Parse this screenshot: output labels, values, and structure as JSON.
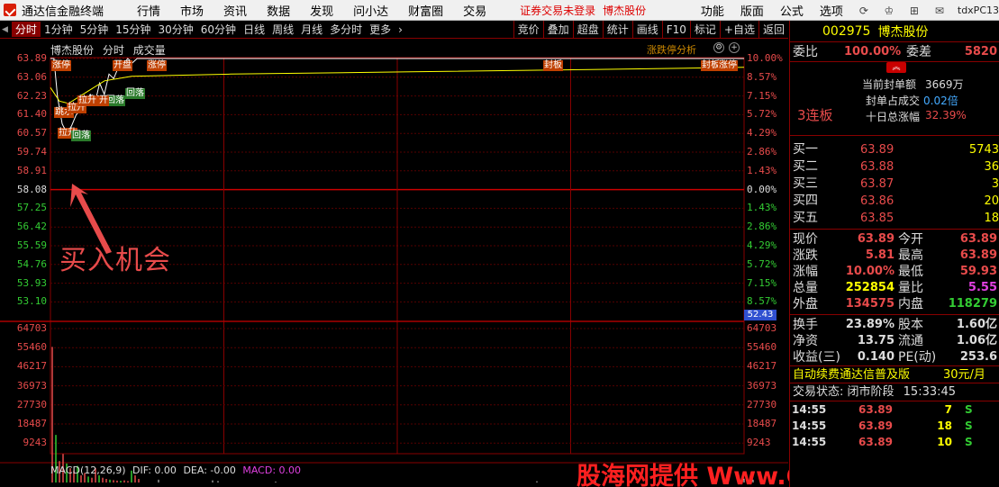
{
  "app": {
    "title": "通达信金融终端",
    "menu": [
      "行情",
      "市场",
      "资讯",
      "数据",
      "发现",
      "问小达",
      "财富圈",
      "交易"
    ],
    "notice": "证券交易未登录",
    "notice_stock": "博杰股份",
    "right_menu": [
      "功能",
      "版面",
      "公式",
      "选项"
    ],
    "machine": "tdxPC13"
  },
  "periods": [
    "分时",
    "1分钟",
    "5分钟",
    "15分钟",
    "30分钟",
    "60分钟",
    "日线",
    "周线",
    "月线",
    "多分时",
    "更多"
  ],
  "tools": [
    "竞价",
    "叠加",
    "超盘",
    "统计",
    "画线",
    "F10",
    "标记",
    "+自选",
    "返回"
  ],
  "chart": {
    "stock_name": "博杰股份",
    "type_label": "分时",
    "volume_label": "成交量",
    "analysis_label": "涨跌停分析",
    "price_labels": [
      "63.89",
      "63.06",
      "62.23",
      "61.40",
      "60.57",
      "59.74",
      "58.91",
      "58.08",
      "57.25",
      "56.42",
      "55.59",
      "54.76",
      "53.93",
      "53.10"
    ],
    "pct_labels": [
      "10.00%",
      "8.57%",
      "7.15%",
      "5.72%",
      "4.29%",
      "2.86%",
      "1.43%",
      "0.00%",
      "1.43%",
      "2.86%",
      "4.29%",
      "5.72%",
      "7.15%",
      "8.57%"
    ],
    "volume_labels": [
      "64703",
      "55460",
      "46217",
      "36973",
      "27730",
      "18487",
      "9243"
    ],
    "current_price_badge": "52.43",
    "buy_annotation": "买入机会",
    "tags": [
      "涨停",
      "跳水",
      "拉升",
      "拉升",
      "回落",
      "回落",
      "回落",
      "打开",
      "开盘",
      "涨停",
      "封板",
      "封板",
      "涨停",
      "拉升"
    ],
    "macd_label": "MACD(12,26,9)",
    "macd_dif": "DIF: 0.00",
    "macd_dea": "DEA: -0.00",
    "macd_val": "MACD: 0.00",
    "watermark": "股海网提供 Www.Guhai.Com.Cn",
    "intraday": {
      "prev_close": 58.08,
      "limit_up": 63.89,
      "avg_end": 63.5,
      "volume_peak": 55460
    }
  },
  "quote": {
    "code": "002975",
    "name": "博杰股份",
    "weibi_label": "委比",
    "weibi_value": "100.00%",
    "weicha_label": "委差",
    "weicha_value": "5820",
    "seal_label": "当前封单额",
    "seal_value": "3669万",
    "seal_ratio_label": "封单占成交",
    "seal_ratio_value": "0.02倍",
    "tenday_label": "十日总涨幅",
    "tenday_value": "32.39%",
    "lianban": "3连板",
    "orders": [
      {
        "label": "买一",
        "price": "63.89",
        "vol": "5743"
      },
      {
        "label": "买二",
        "price": "63.88",
        "vol": "36"
      },
      {
        "label": "买三",
        "price": "63.87",
        "vol": "3"
      },
      {
        "label": "买四",
        "price": "63.86",
        "vol": "20"
      },
      {
        "label": "买五",
        "price": "63.85",
        "vol": "18"
      }
    ],
    "stats": [
      {
        "l1": "现价",
        "v1": "63.89",
        "l2": "今开",
        "v2": "63.89"
      },
      {
        "l1": "涨跌",
        "v1": "5.81",
        "l2": "最高",
        "v2": "63.89"
      },
      {
        "l1": "涨幅",
        "v1": "10.00%",
        "l2": "最低",
        "v2": "59.93"
      },
      {
        "l1": "总量",
        "v1": "252854",
        "l2": "量比",
        "v2": "5.55"
      },
      {
        "l1": "外盘",
        "v1": "134575",
        "l2": "内盘",
        "v2": "118279"
      }
    ],
    "stats2": [
      {
        "l1": "换手",
        "v1": "23.89%",
        "l2": "股本",
        "v2": "1.60亿"
      },
      {
        "l1": "净资",
        "v1": "13.75",
        "l2": "流通",
        "v2": "1.06亿"
      },
      {
        "l1": "收益(三)",
        "v1": "0.140",
        "l2": "PE(动)",
        "v2": "253.6"
      }
    ],
    "ad_text": "自动续费通达信普及版",
    "ad_price": "30元/月",
    "status_label": "交易状态: 闭市阶段",
    "status_time": "15:33:45",
    "ticks": [
      {
        "time": "14:55",
        "price": "63.89",
        "vol": "7",
        "side": "S"
      },
      {
        "time": "14:55",
        "price": "63.89",
        "vol": "18",
        "side": "S"
      },
      {
        "time": "14:55",
        "price": "63.89",
        "vol": "10",
        "side": "S"
      }
    ]
  },
  "colors": {
    "up": "#e84b4b",
    "down": "#33cc33",
    "grid": "#880000",
    "accent": "#ffff00"
  }
}
